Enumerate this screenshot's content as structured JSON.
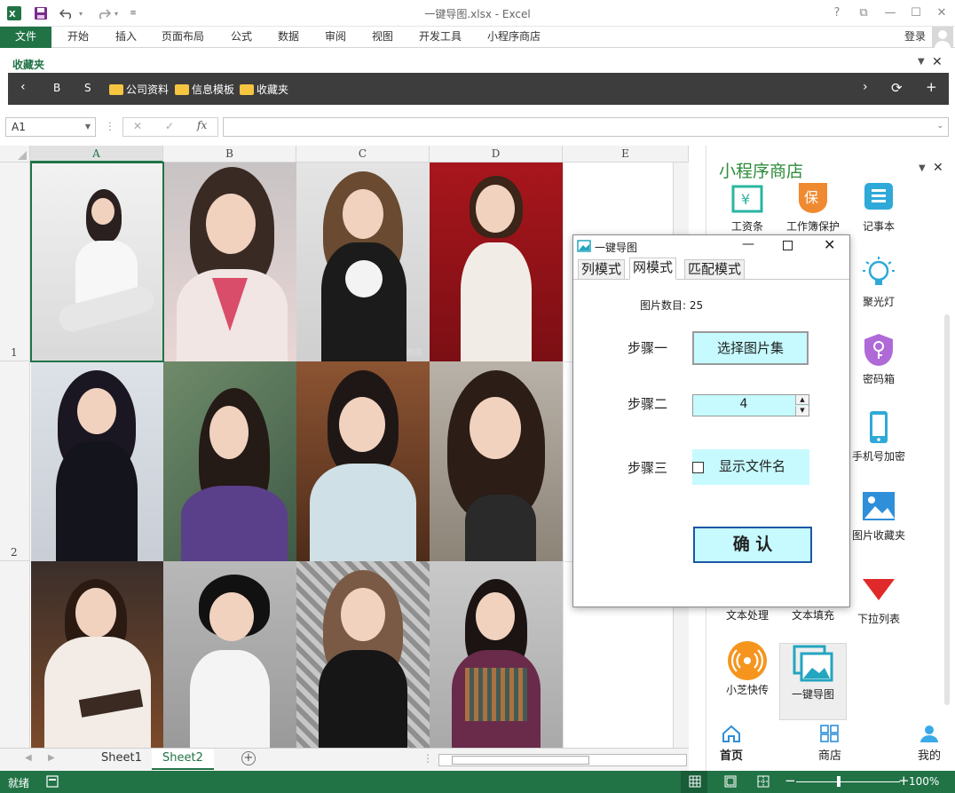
{
  "window": {
    "title": "一键导图.xlsx - Excel"
  },
  "titlebar_controls": {
    "help": "?",
    "restore_ribbon": "⧉",
    "minimize": "—",
    "maximize": "☐",
    "close": "✕"
  },
  "ribbon": {
    "file_tab": "文件",
    "tabs": [
      "开始",
      "插入",
      "页面布局",
      "公式",
      "数据",
      "审阅",
      "视图",
      "开发工具",
      "小程序商店"
    ],
    "login": "登录"
  },
  "favorites": {
    "label": "收藏夹",
    "items": [
      "B",
      "S"
    ],
    "folders": [
      "公司资料",
      "信息模板",
      "收藏夹"
    ]
  },
  "formula_bar": {
    "name_box": "A1",
    "fx": "fx",
    "cancel": "✕",
    "enter": "✓",
    "sep": "⋮"
  },
  "grid": {
    "columns": [
      "A",
      "B",
      "C",
      "D",
      "E"
    ],
    "rows": [
      "1",
      "2"
    ],
    "watermark": "图图"
  },
  "sheets": {
    "tabs": [
      "Sheet1",
      "Sheet2"
    ],
    "active": "Sheet2",
    "add": "+"
  },
  "status": {
    "ready": "就绪",
    "zoom": "100%",
    "minus": "−",
    "plus": "+"
  },
  "panel": {
    "title": "小程序商店",
    "items": [
      {
        "label": "工资条",
        "icon": "payroll-icon"
      },
      {
        "label": "工作簿保护",
        "icon": "workbook-protect-icon"
      },
      {
        "label": "记事本",
        "icon": "notepad-icon"
      },
      {
        "label": "聚光灯",
        "icon": "spotlight-icon"
      },
      {
        "label": "密码箱",
        "icon": "password-box-icon"
      },
      {
        "label": "手机号加密",
        "icon": "phone-encrypt-icon"
      },
      {
        "label": "图片收藏夹",
        "icon": "image-favorites-icon"
      },
      {
        "label": "文本处理",
        "icon": "text-process-icon"
      },
      {
        "label": "文本填充",
        "icon": "text-fill-icon"
      },
      {
        "label": "下拉列表",
        "icon": "dropdown-list-icon"
      },
      {
        "label": "小芝快传",
        "icon": "quick-transfer-icon"
      },
      {
        "label": "一键导图",
        "icon": "one-click-image-icon"
      }
    ],
    "nav": [
      {
        "label": "首页",
        "icon": "home-icon"
      },
      {
        "label": "商店",
        "icon": "store-icon"
      },
      {
        "label": "我的",
        "icon": "user-icon"
      }
    ]
  },
  "dialog": {
    "title": "一键导图",
    "tabs": [
      "列模式",
      "网模式",
      "匹配模式"
    ],
    "active_tab": "网模式",
    "image_count_label": "图片数目:",
    "image_count": "25",
    "step1": "步骤一",
    "step1_button": "选择图片集",
    "step2": "步骤二",
    "step2_value": "4",
    "step3": "步骤三",
    "step3_checkbox": "显示文件名",
    "confirm": "确 认"
  },
  "colors": {
    "excel_green": "#217346",
    "cyan_button": "#c6fafe",
    "panel_green": "#2e8b3a"
  }
}
